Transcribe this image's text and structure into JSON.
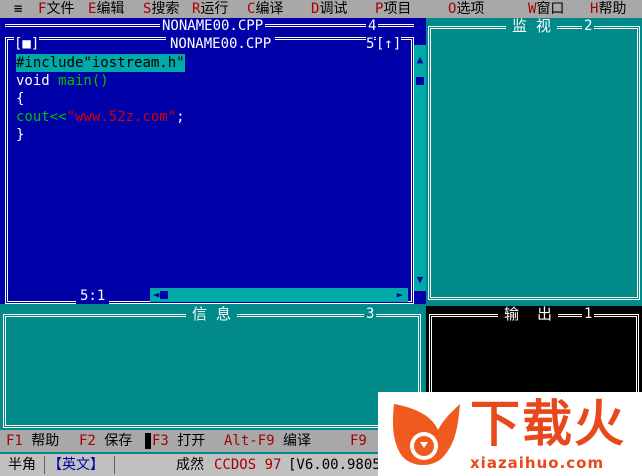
{
  "menu": {
    "system": "≡",
    "items": [
      {
        "hotkey": "F",
        "label": "文件"
      },
      {
        "hotkey": "E",
        "label": "编辑"
      },
      {
        "hotkey": "S",
        "label": "搜索"
      },
      {
        "hotkey": "R",
        "label": "运行"
      },
      {
        "hotkey": "C",
        "label": "编译"
      },
      {
        "hotkey": "D",
        "label": "调试"
      },
      {
        "hotkey": "P",
        "label": "项目"
      },
      {
        "hotkey": "O",
        "label": "选项"
      },
      {
        "hotkey": "W",
        "label": "窗口"
      },
      {
        "hotkey": "H",
        "label": "帮助"
      }
    ]
  },
  "background_window": {
    "title": "NONAME00.CPP",
    "number": "4"
  },
  "editor": {
    "close_box": "[■]",
    "title": "NONAME00.CPP",
    "window_number": "5",
    "zoom_box": "[↑]",
    "code": {
      "line0_directive": "#include",
      "line0_string": "\"iostream.h\"",
      "line1_kw": "void",
      "line1_rest": " main()",
      "line2": "{",
      "line3_kw": "cout<<",
      "line3_string": "\"www.52z.com\"",
      "line3_end": ";",
      "line4": "}"
    },
    "cursor_pos": "5:1"
  },
  "watch": {
    "title": "监 视",
    "number": "2"
  },
  "message": {
    "title": "信 息",
    "number": "3"
  },
  "output": {
    "title": "输  出",
    "number": "1"
  },
  "fkeys": [
    {
      "key": "F1",
      "label": "帮助"
    },
    {
      "key": "F2",
      "label": "保存"
    },
    {
      "key": "F3",
      "label": "打开"
    },
    {
      "key": "Alt-F9",
      "label": "编译"
    },
    {
      "key": "F9",
      "label": ""
    }
  ],
  "status": {
    "half_width": "半角",
    "input_mode": "【英文】",
    "app_name": "成然",
    "product": "CCDOS 97",
    "version": "[V6.00.9805"
  },
  "watermark": {
    "cn": "下载火",
    "url": "xiazaihuo.com"
  },
  "colors": {
    "editor_bg": "#0000a8",
    "panel_bg": "#008a8a",
    "menu_bg": "#a8a8a8",
    "hotkey": "#a80000",
    "string": "#d80000",
    "keyword": "#00c000"
  }
}
